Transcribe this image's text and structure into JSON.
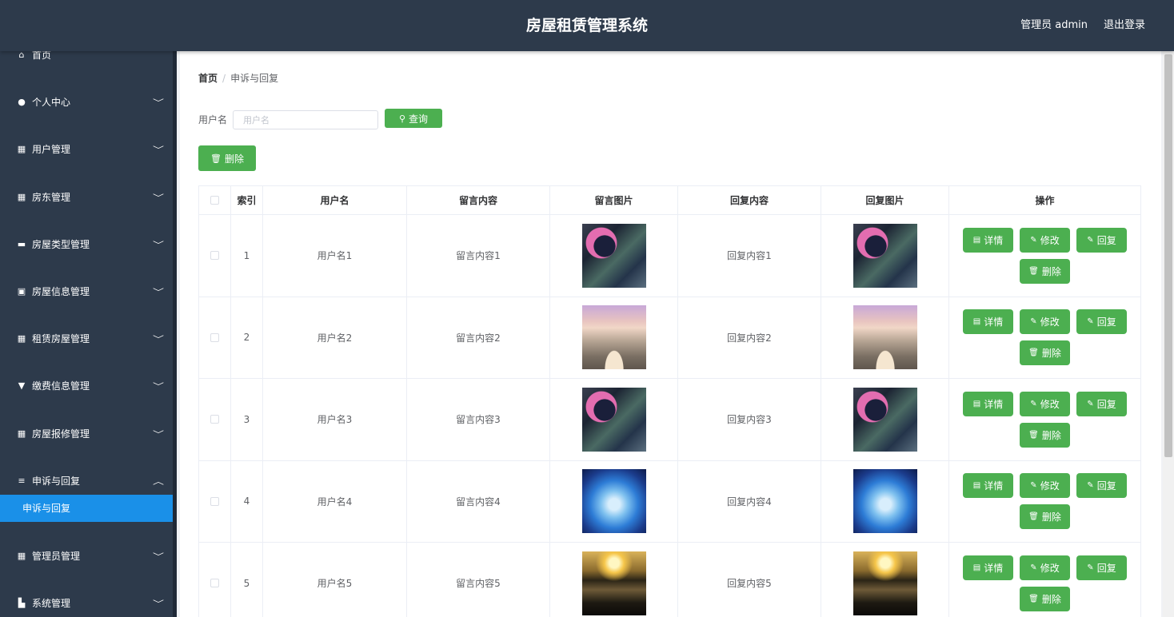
{
  "header": {
    "title": "房屋租赁管理系统",
    "user": "管理员 admin",
    "logout": "退出登录"
  },
  "sidebar": {
    "items": [
      {
        "label": "首页",
        "icon": "home-icon",
        "glyph": "⌂",
        "has_children": false
      },
      {
        "label": "个人中心",
        "icon": "user-icon",
        "glyph": "●",
        "has_children": true
      },
      {
        "label": "用户管理",
        "icon": "grid-icon",
        "glyph": "▦",
        "has_children": true
      },
      {
        "label": "房东管理",
        "icon": "grid-icon",
        "glyph": "▦",
        "has_children": true
      },
      {
        "label": "房屋类型管理",
        "icon": "drawer-icon",
        "glyph": "▬",
        "has_children": true
      },
      {
        "label": "房屋信息管理",
        "icon": "briefcase-icon",
        "glyph": "▣",
        "has_children": true
      },
      {
        "label": "租赁房屋管理",
        "icon": "table-icon",
        "glyph": "▦",
        "has_children": true
      },
      {
        "label": "缴费信息管理",
        "icon": "trophy-icon",
        "glyph": "▼",
        "has_children": true
      },
      {
        "label": "房屋报修管理",
        "icon": "grid-icon",
        "glyph": "▦",
        "has_children": true
      },
      {
        "label": "申诉与回复",
        "icon": "list-icon",
        "glyph": "≡",
        "has_children": true,
        "expanded": true
      },
      {
        "label": "管理员管理",
        "icon": "grid-icon",
        "glyph": "▦",
        "has_children": true
      },
      {
        "label": "系统管理",
        "icon": "system-icon",
        "glyph": "▙",
        "has_children": true
      }
    ],
    "submenu_active": "申诉与回复"
  },
  "breadcrumb": {
    "home": "首页",
    "separator": "/",
    "current": "申诉与回复"
  },
  "search": {
    "label": "用户名",
    "placeholder": "用户名",
    "button": "查询"
  },
  "toolbar": {
    "delete": "删除"
  },
  "table": {
    "headers": [
      "",
      "索引",
      "用户名",
      "留言内容",
      "留言图片",
      "回复内容",
      "回复图片",
      "操作"
    ],
    "actions": {
      "detail": "详情",
      "edit": "修改",
      "reply": "回复",
      "delete": "删除"
    },
    "rows": [
      {
        "index": "1",
        "username": "用户名1",
        "message": "留言内容1",
        "reply": "回复内容1",
        "image": "night-moon-garden"
      },
      {
        "index": "2",
        "username": "用户名2",
        "message": "留言内容2",
        "reply": "回复内容2",
        "image": "rainbow-path"
      },
      {
        "index": "3",
        "username": "用户名3",
        "message": "留言内容3",
        "reply": "回复内容3",
        "image": "night-moon-garden"
      },
      {
        "index": "4",
        "username": "用户名4",
        "message": "留言内容4",
        "reply": "回复内容4",
        "image": "blue-glow-figure"
      },
      {
        "index": "5",
        "username": "用户名5",
        "message": "留言内容5",
        "reply": "回复内容5",
        "image": "sunset-sea"
      }
    ]
  },
  "colors": {
    "header_bg": "#2d3a4b",
    "accent_green": "#4caf50",
    "active_blue": "#1a90e8"
  }
}
